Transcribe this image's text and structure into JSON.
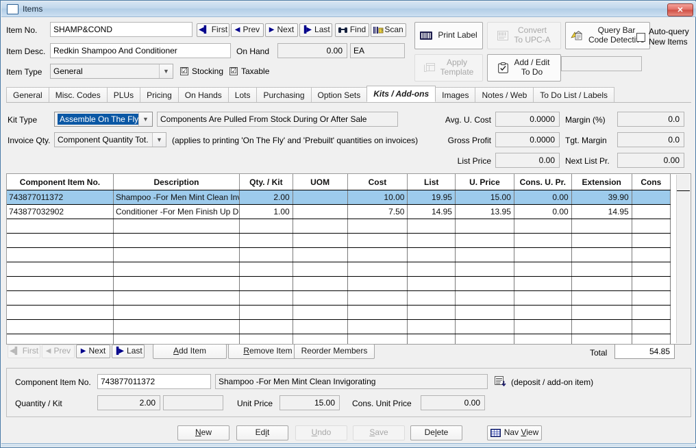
{
  "window": {
    "title": "Items",
    "icon": "window-icon",
    "close_label": "✕"
  },
  "header": {
    "item_no_label": "Item No.",
    "item_no_value": "SHAMP&COND",
    "item_desc_label": "Item Desc.",
    "item_desc_value": "Redkin Shampoo And Conditioner",
    "item_type_label": "Item Type",
    "item_type_value": "General",
    "on_hand_label": "On Hand",
    "on_hand_value": "0.00",
    "uom_value": "EA",
    "stocking_label": "Stocking",
    "stocking_checked": "☑",
    "taxable_label": "Taxable",
    "taxable_checked": "☑",
    "nav": [
      {
        "label": "First",
        "icon": "first-icon",
        "glyph": "◀▌",
        "enabled": true
      },
      {
        "label": "Prev",
        "icon": "prev-icon",
        "glyph": "◀",
        "enabled": true
      },
      {
        "label": "Next",
        "icon": "next-icon",
        "glyph": "▶",
        "enabled": true
      },
      {
        "label": "Last",
        "icon": "last-icon",
        "glyph": "▐▶",
        "enabled": true
      }
    ],
    "find_label": "Find",
    "scan_label": "Scan",
    "print_label": "Print Label",
    "convert_label_1": "Convert",
    "convert_label_2": "To UPC-A",
    "apply_label_1": "Apply",
    "apply_label_2": "Template",
    "add_edit_label_1": "Add / Edit",
    "add_edit_label_2": "To Do",
    "query_bar_label_1": "Query Bar",
    "query_bar_label_2": "Code Detective",
    "autoquery_label_1": "Auto-query",
    "autoquery_label_2": "New Items",
    "autoquery_checked": "",
    "blank_field_value": ""
  },
  "tabs": [
    {
      "label": "General",
      "active": false
    },
    {
      "label": "Misc. Codes",
      "active": false
    },
    {
      "label": "PLUs",
      "active": false
    },
    {
      "label": "Pricing",
      "active": false
    },
    {
      "label": "On Hands",
      "active": false
    },
    {
      "label": "Lots",
      "active": false
    },
    {
      "label": "Purchasing",
      "active": false
    },
    {
      "label": "Option Sets",
      "active": false
    },
    {
      "label": "Kits / Add-ons",
      "active": true
    },
    {
      "label": "Images",
      "active": false
    },
    {
      "label": "Notes / Web",
      "active": false
    },
    {
      "label": "To Do List / Labels",
      "active": false
    }
  ],
  "kit": {
    "kit_type_label": "Kit Type",
    "kit_type_value": "Assemble On The Fly",
    "kit_type_description": "Components Are Pulled From Stock During Or After Sale",
    "invoice_qty_label": "Invoice Qty.",
    "invoice_qty_value": "Component Quantity Tot.",
    "invoice_qty_note": "(applies to printing 'On The Fly' and 'Prebuilt' quantities on invoices)"
  },
  "totals": {
    "avg_u_cost_label": "Avg. U. Cost",
    "avg_u_cost_value": "0.0000",
    "gross_profit_label": "Gross Profit",
    "gross_profit_value": "0.0000",
    "list_price_label": "List Price",
    "list_price_value": "0.00",
    "margin_label": "Margin (%)",
    "margin_value": "0.0",
    "tgt_margin_label": "Tgt. Margin",
    "tgt_margin_value": "0.0",
    "next_list_pr_label": "Next List Pr.",
    "next_list_pr_value": "0.00"
  },
  "grid": {
    "columns": [
      "Component Item No.",
      "Description",
      "Qty. / Kit",
      "UOM",
      "Cost",
      "List",
      "U. Price",
      "Cons. U. Pr.",
      "Extension",
      "Cons"
    ],
    "rows": [
      {
        "selected": true,
        "cells": [
          "743877011372",
          "Shampoo -For Men Mint Clean Invigorating",
          "2.00",
          "",
          "10.00",
          "19.95",
          "15.00",
          "0.00",
          "39.90",
          ""
        ]
      },
      {
        "selected": false,
        "cells": [
          "743877032902",
          "Conditioner -For Men Finish Up Deep",
          "1.00",
          "",
          "7.50",
          "14.95",
          "13.95",
          "0.00",
          "14.95",
          ""
        ]
      }
    ],
    "empty_rows": 11
  },
  "gridnav": {
    "buttons": [
      {
        "label": "First",
        "icon": "first-icon",
        "glyph": "◀▌",
        "enabled": false
      },
      {
        "label": "Prev",
        "icon": "prev-icon",
        "glyph": "◀",
        "enabled": false
      },
      {
        "label": "Next",
        "icon": "next-icon",
        "glyph": "▶",
        "enabled": true
      },
      {
        "label": "Last",
        "icon": "last-icon",
        "glyph": "▐▶",
        "enabled": true
      }
    ],
    "add_item_label": "Add Item",
    "add_item_accel": "A",
    "remove_item_label": "Remove Item",
    "remove_item_accel": "R",
    "reorder_label": "Reorder Members",
    "total_label": "Total",
    "total_value": "54.85"
  },
  "detail": {
    "component_item_no_label": "Component Item No.",
    "component_item_no_value": "743877011372",
    "component_desc_value": "Shampoo -For Men Mint Clean Invigorating",
    "list_icon": "list-lookup-icon",
    "deposit_note": "(deposit / add-on item)",
    "quantity_label": "Quantity / Kit",
    "quantity_value": "2.00",
    "quantity_extra_value": "",
    "unit_price_label": "Unit Price",
    "unit_price_value": "15.00",
    "cons_unit_price_label": "Cons. Unit Price",
    "cons_unit_price_value": "0.00"
  },
  "footer": {
    "buttons": [
      {
        "label": "New",
        "accel": "N",
        "enabled": true
      },
      {
        "label": "Edit",
        "accel": "i",
        "enabled": true
      },
      {
        "label": "Undo",
        "accel": "U",
        "enabled": false
      },
      {
        "label": "Save",
        "accel": "S",
        "enabled": false
      },
      {
        "label": "Delete",
        "accel": "l",
        "enabled": true
      }
    ],
    "nav_view_label": "Nav View",
    "nav_view_icon": "grid-icon"
  },
  "colors": {
    "accent": "#0a57a4",
    "selection": "#9dcbec",
    "titlebar": "#c2d8ec",
    "close": "#cf4f45"
  }
}
